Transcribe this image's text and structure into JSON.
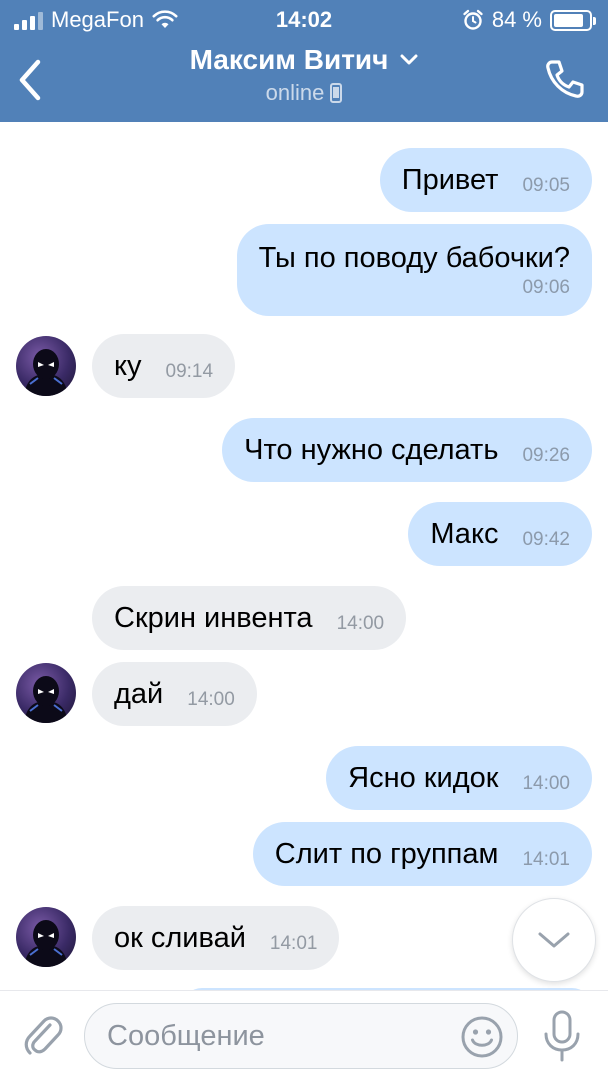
{
  "status_bar": {
    "carrier": "MegaFon",
    "time": "14:02",
    "battery_percent": "84 %",
    "battery_level": 0.84
  },
  "header": {
    "contact_name": "Максим Витич",
    "status": "online",
    "bg_color": "#5181b8"
  },
  "messages": [
    {
      "dir": "out",
      "text": "Привет",
      "time": "09:05"
    },
    {
      "dir": "out",
      "text": "Ты по поводу бабочки?",
      "time": "09:06"
    },
    {
      "dir": "in",
      "text": "ку",
      "time": "09:14"
    },
    {
      "dir": "out",
      "text": "Что нужно сделать",
      "time": "09:26"
    },
    {
      "dir": "out",
      "text": "Макс",
      "time": "09:42"
    },
    {
      "dir": "in",
      "text": "Скрин инвента",
      "time": "14:00"
    },
    {
      "dir": "in",
      "text": "дай",
      "time": "14:00"
    },
    {
      "dir": "out",
      "text": "Ясно кидок",
      "time": "14:00"
    },
    {
      "dir": "out",
      "text": "Слит по группам",
      "time": "14:01"
    },
    {
      "dir": "in",
      "text": "ок сливай",
      "time": "14:01"
    }
  ],
  "input": {
    "placeholder": "Сообщение"
  },
  "colors": {
    "outgoing_bubble": "#cce4ff",
    "incoming_bubble": "#ebedf0"
  },
  "icons": [
    "signal-icon",
    "wifi-icon",
    "alarm-icon",
    "battery-icon",
    "back-arrow-icon",
    "chevron-down-icon",
    "phone-icon",
    "mobile-device-icon",
    "avatar",
    "scroll-down-chevron-icon",
    "paperclip-icon",
    "emoji-icon",
    "microphone-icon"
  ]
}
